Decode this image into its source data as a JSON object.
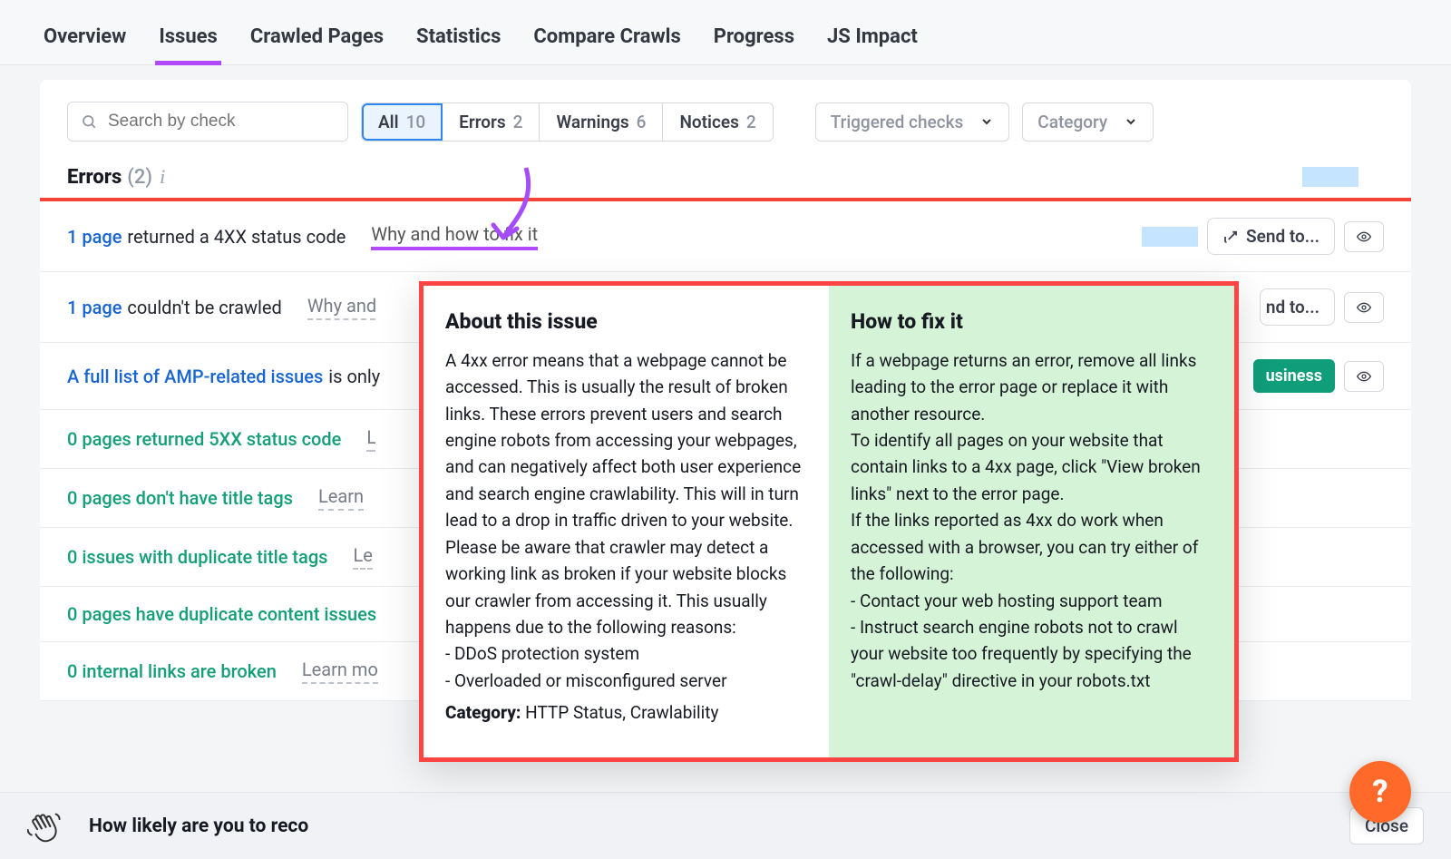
{
  "tabs": {
    "items": [
      {
        "label": "Overview"
      },
      {
        "label": "Issues"
      },
      {
        "label": "Crawled Pages"
      },
      {
        "label": "Statistics"
      },
      {
        "label": "Compare Crawls"
      },
      {
        "label": "Progress"
      },
      {
        "label": "JS Impact"
      }
    ],
    "activeIndex": 1
  },
  "search": {
    "placeholder": "Search by check",
    "value": ""
  },
  "filters": {
    "all": {
      "label": "All",
      "count": "10"
    },
    "errors": {
      "label": "Errors",
      "count": "2"
    },
    "warnings": {
      "label": "Warnings",
      "count": "6"
    },
    "notices": {
      "label": "Notices",
      "count": "2"
    }
  },
  "triggeredChecks": {
    "label": "Triggered checks"
  },
  "category": {
    "label": "Category"
  },
  "section": {
    "title": "Errors",
    "count": "(2)"
  },
  "rows": [
    {
      "link": "1 page",
      "text": " returned a 4XX status code",
      "why": "Why and how to fix it"
    },
    {
      "link": "1 page",
      "text": " couldn't be crawled",
      "why": "Why and how to fix it"
    },
    {
      "link": "A full list of AMP-related issues",
      "text": " is only",
      "why": "",
      "badge": "usiness"
    },
    {
      "green": "0 pages returned 5XX status code",
      "why": "Learn more"
    },
    {
      "green": "0 pages don't have title tags",
      "why": "Learn"
    },
    {
      "green": "0 issues with duplicate title tags",
      "why": "Le"
    },
    {
      "green": "0 pages have duplicate content issues",
      "why": ""
    },
    {
      "green": "0 internal links are broken",
      "why": "Learn mo"
    }
  ],
  "sendTo": {
    "label": "Send to..."
  },
  "popover": {
    "aboutTitle": "About this issue",
    "aboutBody": "A 4xx error means that a webpage cannot be accessed. This is usually the result of broken links. These errors prevent users and search engine robots from accessing your webpages, and can negatively affect both user experience and search engine crawlability. This will in turn lead to a drop in traffic driven to your website. Please be aware that crawler may detect a working link as broken if your website blocks our crawler from accessing it. This usually happens due to the following reasons:\n- DDoS protection system\n- Overloaded or misconfigured server",
    "categoryLabel": "Category:",
    "categoryValue": " HTTP Status, Crawlability",
    "fixTitle": "How to fix it",
    "fixBody": "If a webpage returns an error, remove all links leading to the error page or replace it with another resource.\nTo identify all pages on your website that contain links to a 4xx page, click \"View broken links\" next to the error page.\nIf the links reported as 4xx do work when accessed with a browser, you can try either of the following:\n- Contact your web hosting support team\n- Instruct search engine robots not to crawl your website too frequently by specifying the \"crawl-delay\" directive in your robots.txt"
  },
  "feedback": {
    "text": "How likely are you to reco",
    "close": "Close"
  },
  "fab": "?"
}
